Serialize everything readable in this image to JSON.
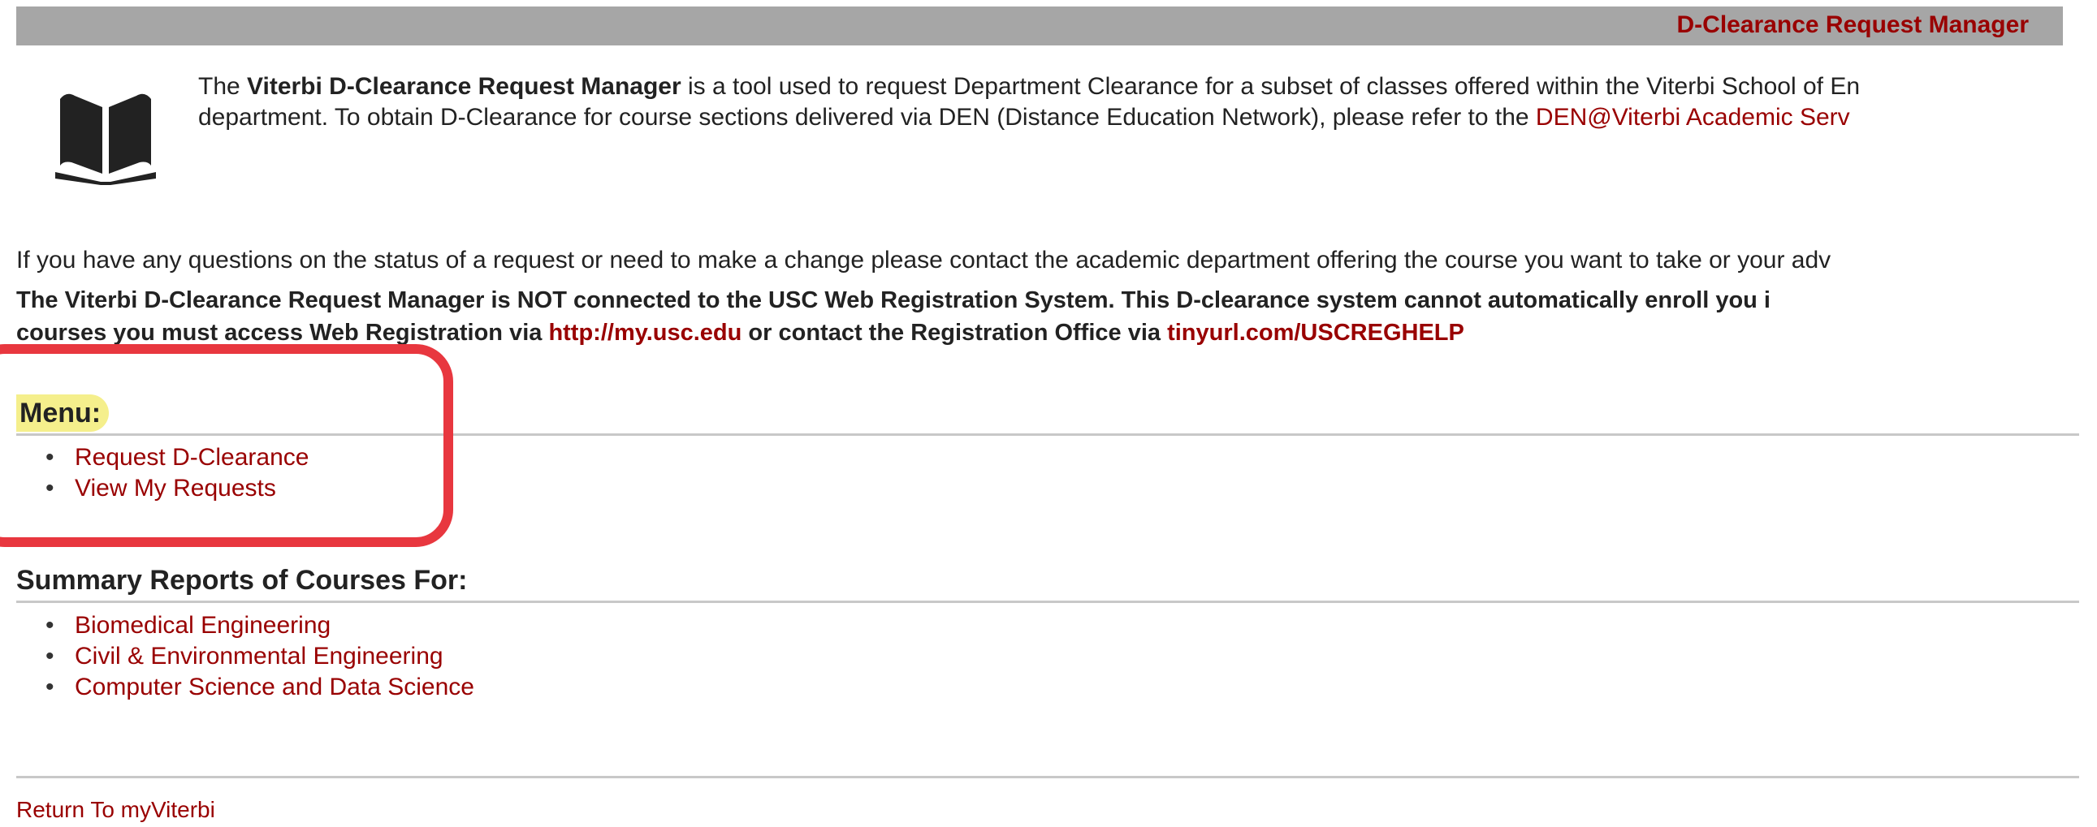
{
  "header": {
    "app_title": "D-Clearance Request Manager",
    "icon": "book-icon",
    "background_color": "#a6a6a6",
    "title_color": "#990000"
  },
  "intro": {
    "line1_prefix": "The ",
    "line1_bold": "Viterbi D-Clearance Request Manager",
    "line1_rest": " is a tool used to request Department Clearance for a subset of classes offered within the Viterbi School of En",
    "line2_text": "department. To obtain D-Clearance for course sections delivered via DEN (Distance Education Network), please refer to the ",
    "line2_link": "DEN@Viterbi Academic Serv"
  },
  "questions_text": "If you have any questions on the status of a request or need to make a change please contact the academic department offering the course you want to take or your adv",
  "warning": {
    "line1": "The Viterbi D-Clearance Request Manager is NOT connected to the USC Web Registration System. This D-clearance system cannot automatically enroll you i",
    "line2_prefix": "courses you must access Web Registration via ",
    "link1": "http://my.usc.edu",
    "line2_mid": " or contact the Registration Office via ",
    "link2": "tinyurl.com/USCREGHELP"
  },
  "menu": {
    "heading": "Menu:",
    "items": [
      {
        "label": "Request D-Clearance"
      },
      {
        "label": "View My Requests"
      }
    ]
  },
  "summary": {
    "heading": "Summary Reports of Courses For:",
    "items": [
      {
        "label": "Biomedical Engineering"
      },
      {
        "label": "Civil & Environmental Engineering"
      },
      {
        "label": "Computer Science and Data Science"
      }
    ]
  },
  "footer": {
    "return_link": "Return To myViterbi"
  },
  "colors": {
    "link": "#990000",
    "menu_highlight": "#f5ef8c",
    "annotation_box": "#e8373f"
  }
}
